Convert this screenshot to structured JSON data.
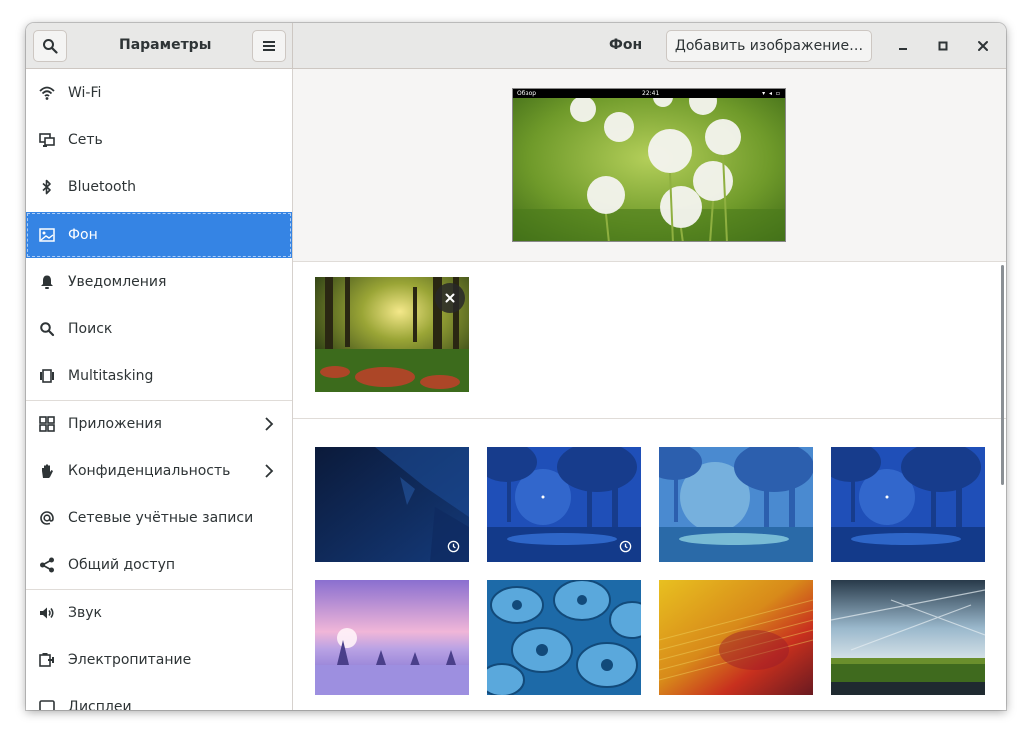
{
  "header": {
    "app_title": "Параметры",
    "page_title": "Фон",
    "add_image_label": "Добавить изображение…"
  },
  "sidebar": {
    "items": [
      {
        "label": "Wi-Fi",
        "icon": "wifi-icon"
      },
      {
        "label": "Сеть",
        "icon": "network-icon"
      },
      {
        "label": "Bluetooth",
        "icon": "bluetooth-icon"
      },
      {
        "label": "Фон",
        "icon": "background-icon",
        "active": true
      },
      {
        "label": "Уведомления",
        "icon": "bell-icon"
      },
      {
        "label": "Поиск",
        "icon": "search-icon"
      },
      {
        "label": "Multitasking",
        "icon": "multitasking-icon"
      },
      {
        "label": "Приложения",
        "icon": "apps-icon",
        "has_submenu": true
      },
      {
        "label": "Конфиденциальность",
        "icon": "hand-icon",
        "has_submenu": true
      },
      {
        "label": "Сетевые учётные записи",
        "icon": "at-icon"
      },
      {
        "label": "Общий доступ",
        "icon": "share-icon"
      },
      {
        "label": "Звук",
        "icon": "speaker-icon"
      },
      {
        "label": "Электропитание",
        "icon": "power-icon"
      },
      {
        "label": "Дисплеи",
        "icon": "display-icon"
      }
    ]
  },
  "preview": {
    "overview_label": "Обзор",
    "clock": "22:41"
  },
  "colors": {
    "accent": "#3584e4",
    "headerbar": "#e8e8e7"
  }
}
